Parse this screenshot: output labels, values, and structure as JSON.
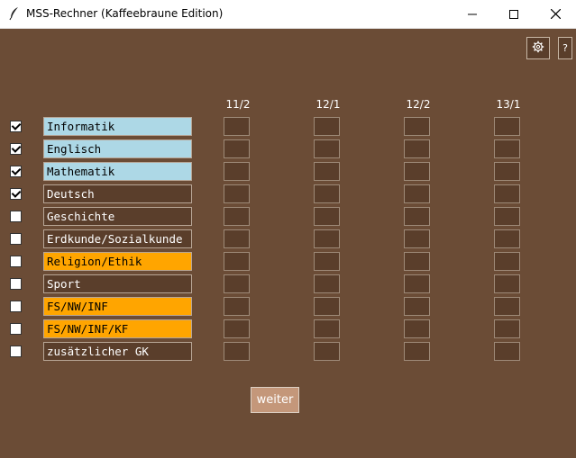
{
  "window": {
    "title": "MSS-Rechner (Kaffeebraune Edition)",
    "icon": "feather-icon"
  },
  "toolbar": {
    "settings_icon": "gear-icon",
    "help_label": "?"
  },
  "columns": [
    "11/2",
    "12/1",
    "12/2",
    "13/1"
  ],
  "subjects": [
    {
      "label": "Informatik",
      "checked": true,
      "color": "#add8e6"
    },
    {
      "label": "Englisch",
      "checked": true,
      "color": "#add8e6"
    },
    {
      "label": "Mathematik",
      "checked": true,
      "color": "#add8e6"
    },
    {
      "label": "Deutsch",
      "checked": true,
      "color": "#5a3e2b"
    },
    {
      "label": "Geschichte",
      "checked": false,
      "color": "#5a3e2b"
    },
    {
      "label": "Erdkunde/Sozialkunde",
      "checked": false,
      "color": "#5a3e2b"
    },
    {
      "label": "Religion/Ethik",
      "checked": false,
      "color": "#ffa500"
    },
    {
      "label": "Sport",
      "checked": false,
      "color": "#5a3e2b"
    },
    {
      "label": "FS/NW/INF",
      "checked": false,
      "color": "#ffa500"
    },
    {
      "label": "FS/NW/INF/KF",
      "checked": false,
      "color": "#ffa500"
    },
    {
      "label": "zusätzlicher GK",
      "checked": false,
      "color": "#5a3e2b"
    }
  ],
  "next_button": {
    "label": "weiter"
  },
  "colors": {
    "background": "#6b4c36",
    "field_dark": "#5a3e2b",
    "highlight_blue": "#add8e6",
    "highlight_orange": "#ffa500",
    "button": "#c4977a"
  }
}
